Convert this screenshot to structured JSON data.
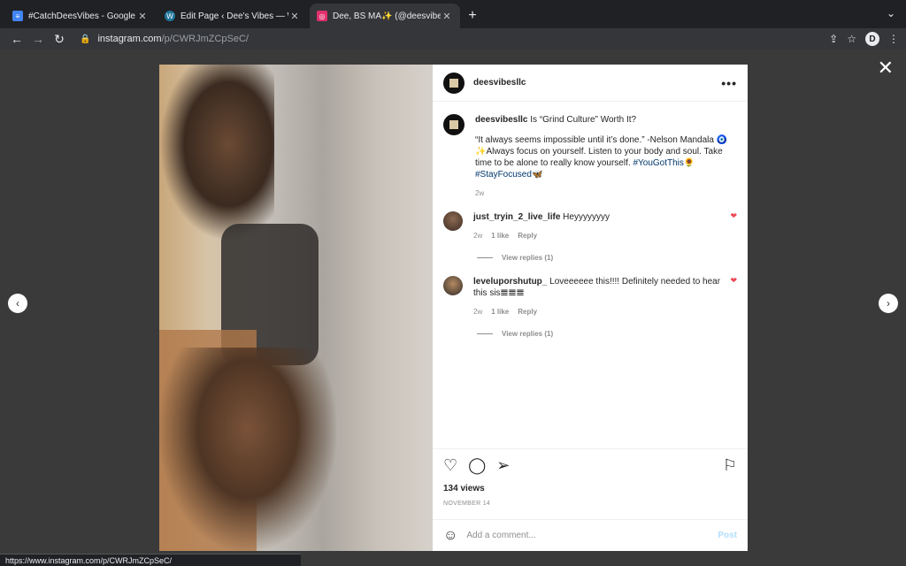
{
  "tabs": [
    {
      "title": "#CatchDeesVibes - Google Do",
      "color": "#4285f4",
      "active": false
    },
    {
      "title": "Edit Page ‹ Dee's Vibes — Wo",
      "color": "#21759b",
      "active": false
    },
    {
      "title": "Dee, BS MA✨ (@deesvibesllc",
      "color": "#e1306c",
      "active": true
    }
  ],
  "address": {
    "host": "instagram.com",
    "path": "/p/CWRJmZCpSeC/"
  },
  "profile_initial": "D",
  "post": {
    "username": "deesvibesllc",
    "caption_title": "Is “Grind Culture” Worth It?",
    "caption_body": "“It always seems impossible until it’s done.” -Nelson Mandala 🧿✨Always focus on yourself. Listen to your body and soul. Take time to be alone to really know yourself.",
    "hashtag1": "#YouGotThis",
    "emoji1": "🌻",
    "hashtag2": "#StayFocused",
    "emoji2": "🦋",
    "caption_age": "2w",
    "comments": [
      {
        "user": "just_tryin_2_live_life",
        "text": "Heyyyyyyyy",
        "age": "2w",
        "likes": "1 like",
        "reply": "Reply",
        "view_replies": "View replies (1)"
      },
      {
        "user": "leveluporshutup_",
        "text": "Loveeeeee this!!!! Definitely needed to hear this sis𝌆𝌆𝌆",
        "age": "2w",
        "likes": "1 like",
        "reply": "Reply",
        "view_replies": "View replies (1)"
      }
    ],
    "views": "134 views",
    "date": "NOVEMBER 14",
    "comment_placeholder": "Add a comment...",
    "post_label": "Post"
  },
  "status_url": "https://www.instagram.com/p/CWRJmZCpSeC/"
}
